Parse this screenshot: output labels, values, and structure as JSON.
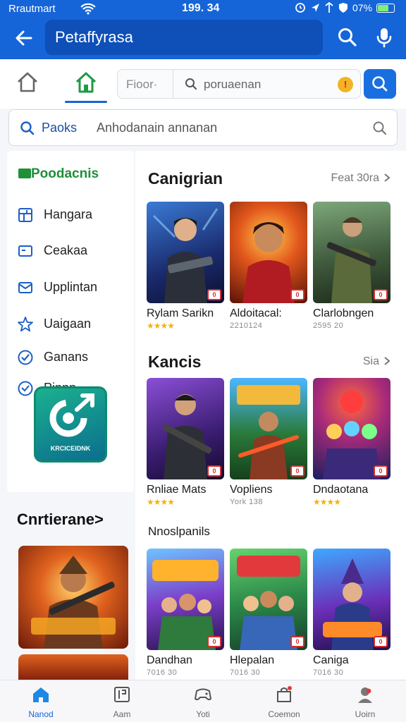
{
  "status_bar": {
    "carrier": "Rrautmart",
    "time": "199. 34",
    "battery": "07%",
    "battery_level": 0.7,
    "icons": [
      "wifi-icon",
      "alarm-icon",
      "location-icon",
      "shield-icon",
      "battery-icon"
    ]
  },
  "app_bar": {
    "title": "Petaffyrasa",
    "icons": [
      "back-arrow-icon",
      "search-icon",
      "mic-icon"
    ]
  },
  "tabs": {
    "filter_label": "Fioor·",
    "filter_placeholder": "poruaenan",
    "badge": "!"
  },
  "search": {
    "label": "Paoks",
    "value": "Anhodanain annanan"
  },
  "sidebar": {
    "brand": "Poodacnis",
    "items": [
      {
        "label": "Hangara",
        "icon": "grid-icon"
      },
      {
        "label": "Ceakaa",
        "icon": "card-icon"
      },
      {
        "label": "Upplintan",
        "icon": "mail-icon"
      },
      {
        "label": "Uaigaan",
        "icon": "star-icon"
      },
      {
        "label": "Ganans",
        "icon": "check-circle-icon"
      },
      {
        "label": "Pinnn",
        "icon": "heart-shield-icon"
      }
    ],
    "promo_text": "KRCICEIDNK"
  },
  "sections": [
    {
      "title": "Canigrian",
      "see_all": "Feat 30ra",
      "cards": [
        {
          "name": "Rylam Sarikn",
          "meta": "",
          "stars": "★★★★",
          "tag": "0"
        },
        {
          "name": "Aldoitacal:",
          "meta": "2210124",
          "stars": "",
          "tag": "0"
        },
        {
          "name": "Clarlobngen",
          "meta": "2595 20",
          "stars": "",
          "tag": "0"
        }
      ]
    },
    {
      "title": "Kancis",
      "see_all": "Sia",
      "cards": [
        {
          "name": "Rnliae Mats",
          "meta": "",
          "stars": "★★★★",
          "tag": "0"
        },
        {
          "name": "Vopliens",
          "meta": "York 138",
          "stars": "",
          "tag": "0"
        },
        {
          "name": "Dndaotana",
          "meta": "",
          "stars": "★★★★",
          "tag": "0"
        }
      ]
    },
    {
      "title": "Nnoslpanils",
      "see_all": "",
      "cards": [
        {
          "name": "Dandhan",
          "meta": "7016 30",
          "stars": "",
          "tag": "0"
        },
        {
          "name": "Hlepalan",
          "meta": "7016 30",
          "stars": "",
          "tag": "0"
        },
        {
          "name": "Caniga",
          "meta": "7016 30",
          "stars": "",
          "tag": "0"
        }
      ]
    }
  ],
  "feature": {
    "title": "Cnrtierane>"
  },
  "bottom_nav": [
    {
      "label": "Nanod",
      "icon": "home-icon"
    },
    {
      "label": "Aam",
      "icon": "library-icon"
    },
    {
      "label": "Yoti",
      "icon": "controller-icon"
    },
    {
      "label": "Coemon",
      "icon": "bag-icon"
    },
    {
      "label": "Uoirn",
      "icon": "profile-icon"
    }
  ],
  "colors": {
    "primary": "#1565d8",
    "brand_green": "#1f8f3a",
    "star": "#f4b400",
    "rating_red": "#d32f2f"
  }
}
